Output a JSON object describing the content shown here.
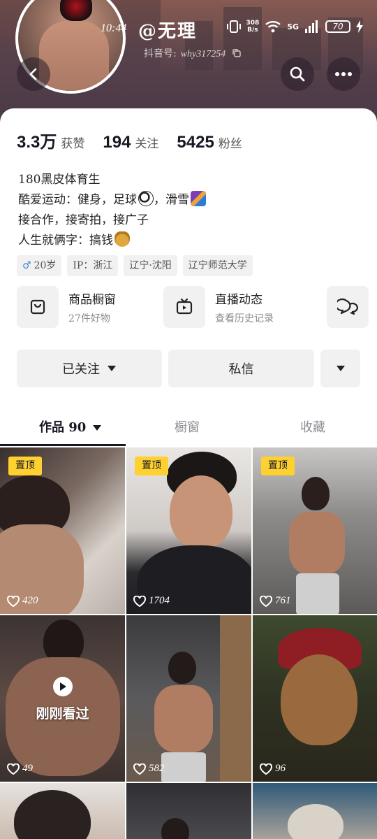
{
  "status_bar": {
    "time": "10:44",
    "net_speed_value": "308",
    "net_speed_unit": "B/s",
    "network": "5G",
    "battery": "70"
  },
  "profile": {
    "nickname": "@无理",
    "id_label": "抖音号:",
    "id_value": "why317254"
  },
  "stats": [
    {
      "value": "3.3万",
      "label": "获赞"
    },
    {
      "value": "194",
      "label": "关注"
    },
    {
      "value": "5425",
      "label": "粉丝"
    }
  ],
  "bio": [
    "180黑皮体育生",
    "酷爱运动：健身，足球",
    "，滑雪",
    "接合作，接寄拍，接广子",
    "人生就俩字：搞钱"
  ],
  "tags": [
    {
      "icon": "male-icon",
      "text": "20岁"
    },
    {
      "text": "IP：浙江"
    },
    {
      "text": "辽宁·沈阳"
    },
    {
      "text": "辽宁师范大学"
    }
  ],
  "features": [
    {
      "title": "商品橱窗",
      "subtitle": "27件好物"
    },
    {
      "title": "直播动态",
      "subtitle": "查看历史记录"
    }
  ],
  "actions": {
    "followed": "已关注",
    "message": "私信"
  },
  "tabs": [
    {
      "label": "作品 90"
    },
    {
      "label": "橱窗"
    },
    {
      "label": "收藏"
    }
  ],
  "posts": [
    {
      "pinned_label": "置顶",
      "likes": "420"
    },
    {
      "pinned_label": "置顶",
      "likes": "1704"
    },
    {
      "pinned_label": "置顶",
      "likes": "761"
    },
    {
      "likes": "49",
      "overlay": "刚刚看过"
    },
    {
      "likes": "582"
    },
    {
      "likes": "96"
    }
  ],
  "colors": {
    "primary_text": "#161823",
    "secondary_text": "#8a8b91",
    "button_bg": "#f1f1f2",
    "pin_badge": "#fed130",
    "header_bg": "#57404a"
  }
}
